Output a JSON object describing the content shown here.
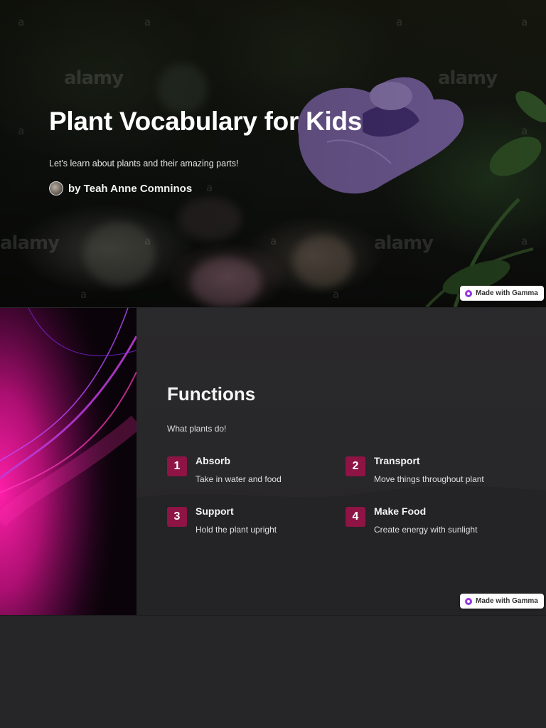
{
  "hero": {
    "title": "Plant Vocabulary for Kids",
    "subtitle": "Let's learn about plants and their amazing parts!",
    "author": "by Teah Anne Comninos",
    "watermark_text": "alamy",
    "watermark_letter": "a",
    "badge_label": "Made with Gamma"
  },
  "functions": {
    "title": "Functions",
    "subtitle": "What plants do!",
    "items": [
      {
        "number": "1",
        "title": "Absorb",
        "description": "Take in water and food"
      },
      {
        "number": "2",
        "title": "Transport",
        "description": "Move things throughout plant"
      },
      {
        "number": "3",
        "title": "Support",
        "description": "Hold the plant upright"
      },
      {
        "number": "4",
        "title": "Make Food",
        "description": "Create energy with sunlight"
      }
    ],
    "badge_label": "Made with Gamma"
  },
  "colors": {
    "background": "#252426",
    "accent": "#8e1445",
    "side_art_magenta": "#e0189a",
    "gamma_brand": "#c135e0"
  },
  "icons": {
    "gamma_logo": "gamma-logo-icon",
    "author_avatar": "avatar"
  }
}
